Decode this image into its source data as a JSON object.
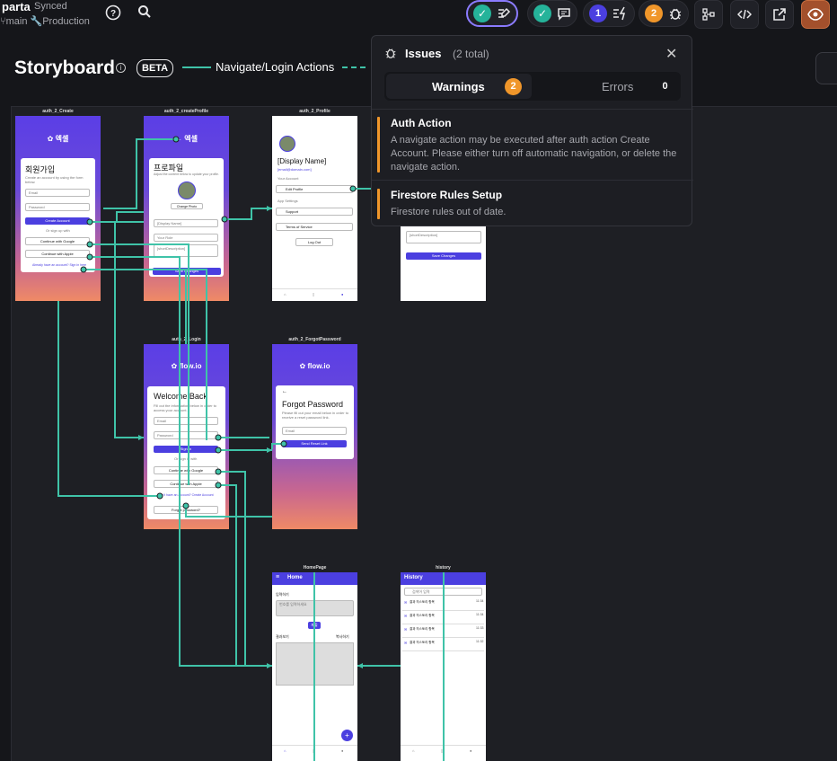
{
  "project": {
    "name": "parta",
    "status": "Synced",
    "branch": "main",
    "environment": "Production"
  },
  "toolbar": {
    "help_icon": "help-circle-icon",
    "search_icon": "search-icon",
    "warning_count": "1",
    "bug_count": "2"
  },
  "storyboard": {
    "title": "Storyboard",
    "badge": "BETA",
    "legend_solid": "Navigate/Login Actions"
  },
  "screens": {
    "auth_create": {
      "label": "auth_2_Create",
      "logo": "엑셀",
      "heading": "회원가입",
      "subtext": "Create an account by using the form below.",
      "email": "Email",
      "password": "Password",
      "create_btn": "Create Account",
      "or_text": "Or sign up with",
      "google_btn": "Continue with Google",
      "apple_btn": "Continue with Apple",
      "login_link": "Already have an account? Sign in here"
    },
    "auth_create_profile": {
      "label": "auth_2_createProfile",
      "logo": "엑셀",
      "heading": "프로파일",
      "subtext": "Adjust the content below to update your profile.",
      "change_photo": "Change Photo",
      "display_name": "[Display Name]",
      "your_role": "Your Role",
      "description": "[shortDescription]",
      "save_btn": "Save Changes"
    },
    "auth_profile": {
      "label": "auth_2_Profile",
      "name": "[Display Name]",
      "email": "[email@domain.com]",
      "your_account": "Your Account",
      "edit_profile": "Edit Profile",
      "app_settings": "App Settings",
      "support": "Support",
      "terms": "Terms of Service",
      "logout": "Log Out"
    },
    "edit_profile": {
      "description": "[shortDescription]",
      "save_btn": "Save Changes"
    },
    "auth_login": {
      "label": "auth_2_Login",
      "logo": "flow.io",
      "heading": "Welcome Back",
      "subtext": "Fill out the information below in order to access your account.",
      "email": "Email",
      "password": "Password",
      "signin_btn": "Sign In",
      "or_text": "Or sign in with",
      "google_btn": "Continue with Google",
      "apple_btn": "Continue with Apple",
      "create_link": "Don't have an account? Create Account",
      "forgot_btn": "Forgot password?"
    },
    "auth_forgot": {
      "label": "auth_2_ForgotPassword",
      "logo": "flow.io",
      "heading": "Forgot Password",
      "subtext": "Please fill out your email below in order to receive a reset password link.",
      "email": "Email",
      "send_btn": "Send Reset Link"
    },
    "homepage": {
      "label": "HomePage",
      "header": "Home",
      "input_label": "입력하기",
      "input_placeholder": "번호를 입력하세요",
      "submit_btn": "제출",
      "result_label": "결과보기",
      "copy_label": "복사하기"
    },
    "history": {
      "label": "history",
      "header": "History",
      "search_placeholder": "검색어 입력",
      "items": [
        {
          "title": "결과 히스토리 항목",
          "time": "11:34"
        },
        {
          "title": "결과 히스토리 항목",
          "time": "11:34"
        },
        {
          "title": "결과 히스토리 항목",
          "time": "11:33"
        },
        {
          "title": "결과 히스토리 항목",
          "time": "11:32"
        }
      ]
    }
  },
  "issues_panel": {
    "title": "Issues",
    "count": "(2 total)",
    "tabs": [
      {
        "label": "Warnings",
        "count": "2"
      },
      {
        "label": "Errors",
        "count": "0"
      }
    ],
    "items": [
      {
        "title": "Auth Action",
        "description": "A navigate action may be executed after auth action Create Account. Please either turn off automatic navigation, or delete the navigate action."
      },
      {
        "title": "Firestore Rules Setup",
        "description": "Firestore rules out of date."
      }
    ]
  },
  "colors": {
    "accent": "#4b3fe0",
    "flow": "#3fc3a8",
    "warning": "#f0962a",
    "preview": "#a3502c"
  }
}
